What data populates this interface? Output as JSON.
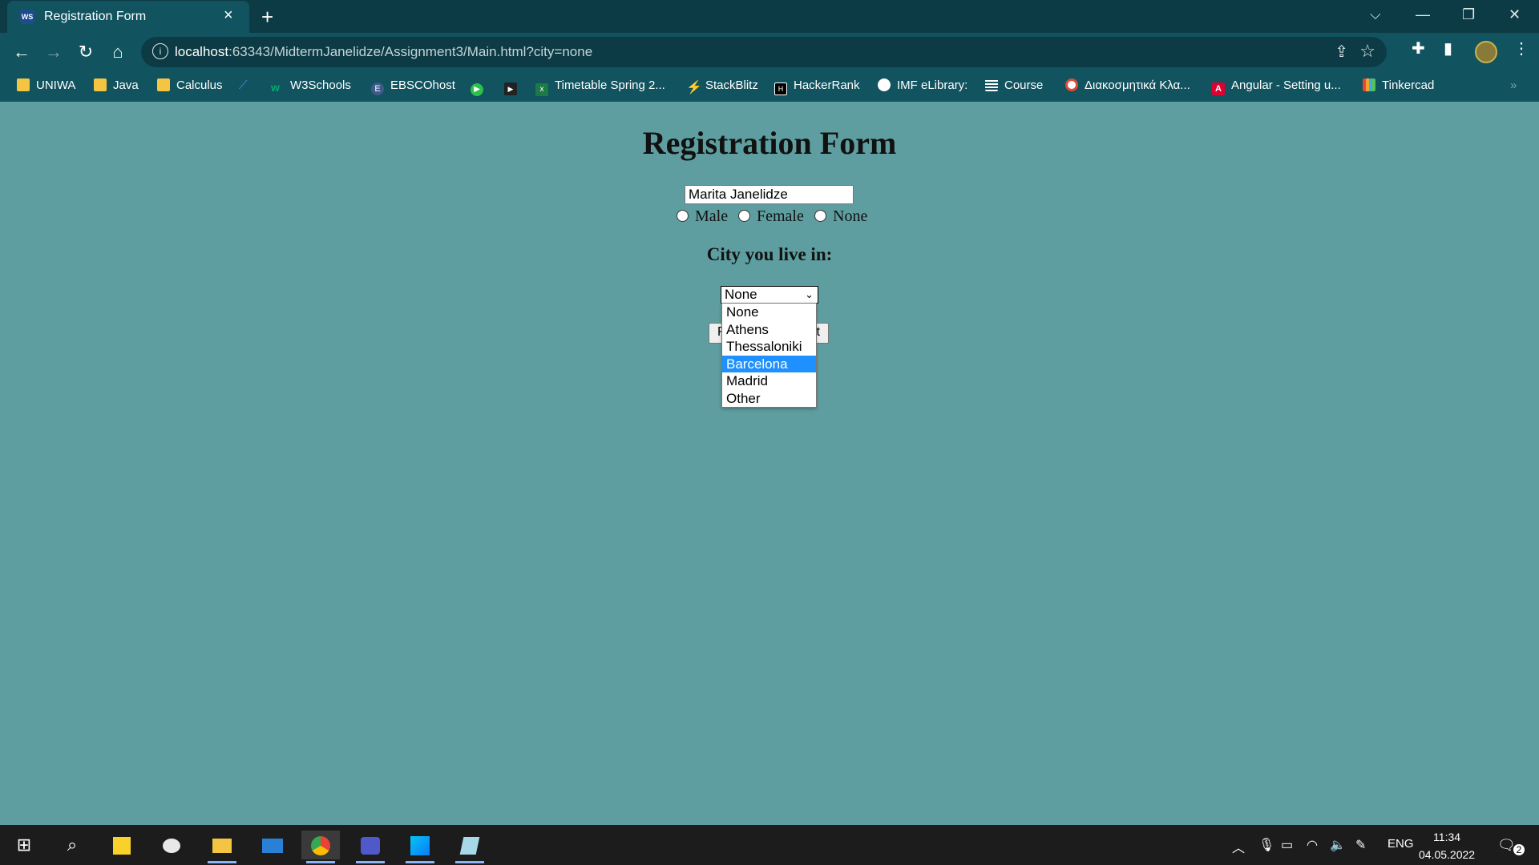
{
  "browser": {
    "tab": {
      "title": "Registration Form",
      "favicon": "WS"
    },
    "url_host": "localhost",
    "url_path": ":63343/MidtermJanelidze/Assignment3/Main.html?city=none",
    "bookmarks": [
      {
        "label": "UNIWA",
        "icon": "folder"
      },
      {
        "label": "Java",
        "icon": "folder"
      },
      {
        "label": "Calculus",
        "icon": "folder"
      },
      {
        "label": "",
        "icon": "tool-icon"
      },
      {
        "label": "W3Schools",
        "icon": "w3schools-icon"
      },
      {
        "label": "EBSCOhost",
        "icon": "ebsco-icon"
      },
      {
        "label": "",
        "icon": "play-circle-icon"
      },
      {
        "label": "",
        "icon": "youtube-icon"
      },
      {
        "label": "Timetable Spring 2...",
        "icon": "excel-icon"
      },
      {
        "label": "StackBlitz",
        "icon": "bolt-icon"
      },
      {
        "label": "HackerRank",
        "icon": "hackerrank-icon"
      },
      {
        "label": "IMF eLibrary:",
        "icon": "imf-icon"
      },
      {
        "label": "Course",
        "icon": "course-icon"
      },
      {
        "label": "Διακοσμητικά Κλα...",
        "icon": "chrome-page-icon"
      },
      {
        "label": "Angular - Setting u...",
        "icon": "angular-icon"
      },
      {
        "label": "Tinkercad",
        "icon": "tinkercad-icon"
      }
    ]
  },
  "page": {
    "title": "Registration Form",
    "name_value": "Marita Janelidze",
    "gender_options": [
      "Male",
      "Female",
      "None"
    ],
    "city_label": "City you live in:",
    "city_selected": "None",
    "city_options": [
      "None",
      "Athens",
      "Thessaloniki",
      "Barcelona",
      "Madrid",
      "Other"
    ],
    "city_highlighted": "Barcelona",
    "submit_left_fragment": "R",
    "submit_right_fragment": "t"
  },
  "taskbar": {
    "language": "ENG",
    "time": "11:34",
    "date": "04.05.2022",
    "notifications": "2"
  },
  "colors": {
    "page_background": "#5f9ea0",
    "browser_chrome": "#11535f",
    "titlebar": "#0d3b45",
    "highlight": "#1e90ff"
  }
}
